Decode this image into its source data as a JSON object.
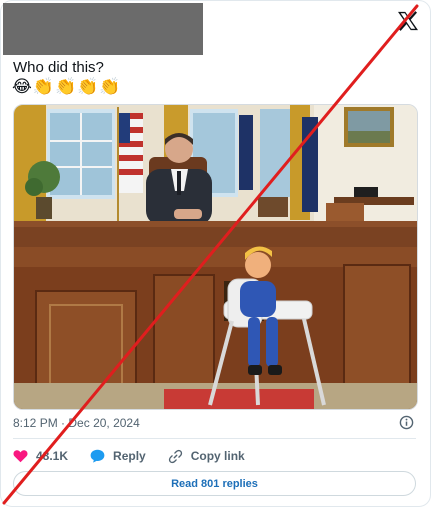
{
  "tweet": {
    "text": "Who did this?",
    "emojis": [
      "😂",
      "👏",
      "👏",
      "👏",
      "👏"
    ]
  },
  "meta": {
    "time": "8:12 PM",
    "separator": "·",
    "date": "Dec 20, 2024"
  },
  "actions": {
    "likes": "48.1K",
    "reply_label": "Reply",
    "copy_link_label": "Copy link"
  },
  "read_replies_label": "Read 801 replies",
  "colors": {
    "like": "#f91880",
    "reply": "#1d9bf0",
    "link_text": "#1d6fb8",
    "cross_line": "#e01e1e",
    "redaction": "#6b6b6b"
  },
  "icons": {
    "logo": "x-logo-icon",
    "info": "info-icon",
    "like": "heart-icon",
    "reply": "speech-bubble-icon",
    "copy": "link-icon"
  }
}
